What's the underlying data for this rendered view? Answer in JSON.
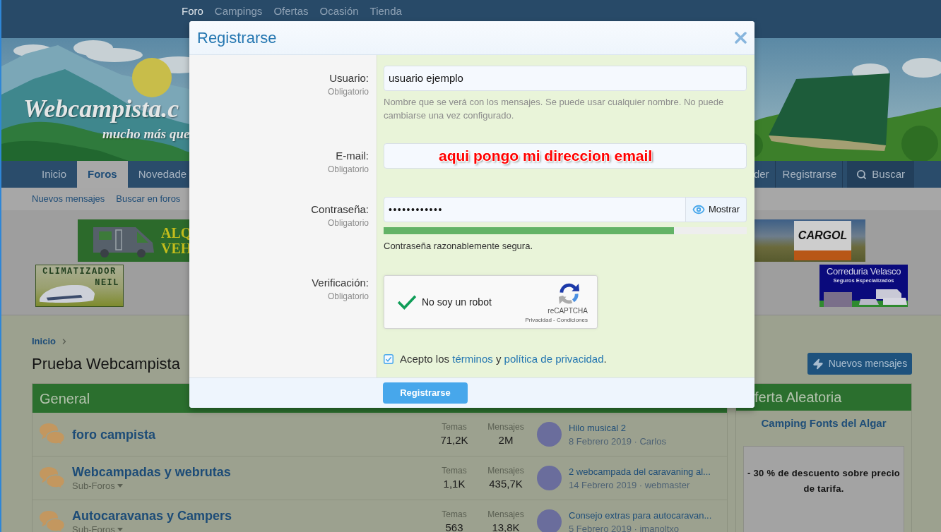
{
  "top_nav": [
    {
      "label": "Foro",
      "selected": true
    },
    {
      "label": "Campings",
      "selected": false
    },
    {
      "label": "Ofertas",
      "selected": false
    },
    {
      "label": "Ocasión",
      "selected": false
    },
    {
      "label": "Tienda",
      "selected": false
    }
  ],
  "banner": {
    "logo": "Webcampista.c",
    "tagline": "mucho más que"
  },
  "nav": {
    "tabs": [
      {
        "label": "Inicio",
        "selected": false
      },
      {
        "label": "Foros",
        "selected": true
      },
      {
        "label": "Novedade",
        "selected": false
      }
    ],
    "right": [
      {
        "kind": "link",
        "label": "der"
      },
      {
        "kind": "link",
        "label": "Registrarse"
      },
      {
        "kind": "search",
        "label": "Buscar"
      }
    ]
  },
  "subnav": [
    "Nuevos mensajes",
    "Buscar en foros"
  ],
  "ads": [
    {
      "kind": "rental",
      "lines": [
        "ALQ",
        "VEH"
      ]
    },
    {
      "kind": "cargol",
      "lines": [
        "CARGOL"
      ]
    },
    {
      "kind": "climatizador",
      "lines": [
        "CLIMATIZADOR",
        "NEIL"
      ]
    },
    {
      "kind": "correduria",
      "lines": [
        "Correduria Velasco",
        "Seguros Especializados"
      ]
    }
  ],
  "breadcrumb": [
    "Inicio"
  ],
  "page_title": "Prueba Webcampista",
  "new_posts_button": "Nuevos mensajes",
  "forum_block": {
    "title": "General",
    "rows": [
      {
        "title": "foro campista",
        "stats": [
          {
            "label": "Temas",
            "value": "71,2K"
          },
          {
            "label": "Mensajes",
            "value": "2M"
          }
        ],
        "latest": {
          "title": "Hilo musical 2",
          "meta": "8 Febrero 2019 · Carlos"
        }
      },
      {
        "title": "Webcampadas y webrutas",
        "subforums": "Sub-Foros",
        "stats": [
          {
            "label": "Temas",
            "value": "1,1K"
          },
          {
            "label": "Mensajes",
            "value": "435,7K"
          }
        ],
        "latest": {
          "title": "2 webcampada del caravaning al...",
          "meta": "14 Febrero 2019 · webmaster"
        }
      },
      {
        "title": "Autocaravanas y Campers",
        "subforums": "Sub-Foros",
        "stats": [
          {
            "label": "Temas",
            "value": "563"
          },
          {
            "label": "Mensajes",
            "value": "13,8K"
          }
        ],
        "latest": {
          "title": "Consejo extras para autocaravan...",
          "meta": "5 Febrero 2019 · imanoltxo"
        }
      }
    ]
  },
  "sidebar": {
    "title": "ferta Aleatoria",
    "offer_name": "Camping Fonts del Algar",
    "offer_text": "- 30 % de descuento sobre precio de tarifa."
  },
  "dialog": {
    "title": "Registrarse",
    "rows": [
      {
        "kind": "text",
        "label": "Usuario:",
        "note": "Obligatorio",
        "value": "usuario ejemplo",
        "hint": "Nombre que se verá con los mensajes. Se puede usar cualquier nombre. No puede cambiarse una vez configurado."
      },
      {
        "kind": "email",
        "label": "E-mail:",
        "note": "Obligatorio",
        "annotation": "aqui pongo mi direccion email"
      },
      {
        "kind": "password",
        "label": "Contraseña:",
        "note": "Obligatorio",
        "value": "••••••••••••",
        "toggle": "Mostrar",
        "level": 0.8,
        "strength": "Contraseña razonablemente segura."
      },
      {
        "kind": "captcha",
        "label": "Verificación:",
        "note": "Obligatorio",
        "checked": true,
        "text": "No soy un robot",
        "brand": "reCAPTCHA",
        "links": "Privacidad - Condiciones"
      }
    ],
    "agree": {
      "checked": true,
      "parts": [
        {
          "kind": "text",
          "text": "Acepto los "
        },
        {
          "kind": "link",
          "text": "términos"
        },
        {
          "kind": "text",
          "text": " y "
        },
        {
          "kind": "link",
          "text": "política de privacidad"
        },
        {
          "kind": "text",
          "text": "."
        }
      ]
    },
    "submit": "Registrarse"
  }
}
